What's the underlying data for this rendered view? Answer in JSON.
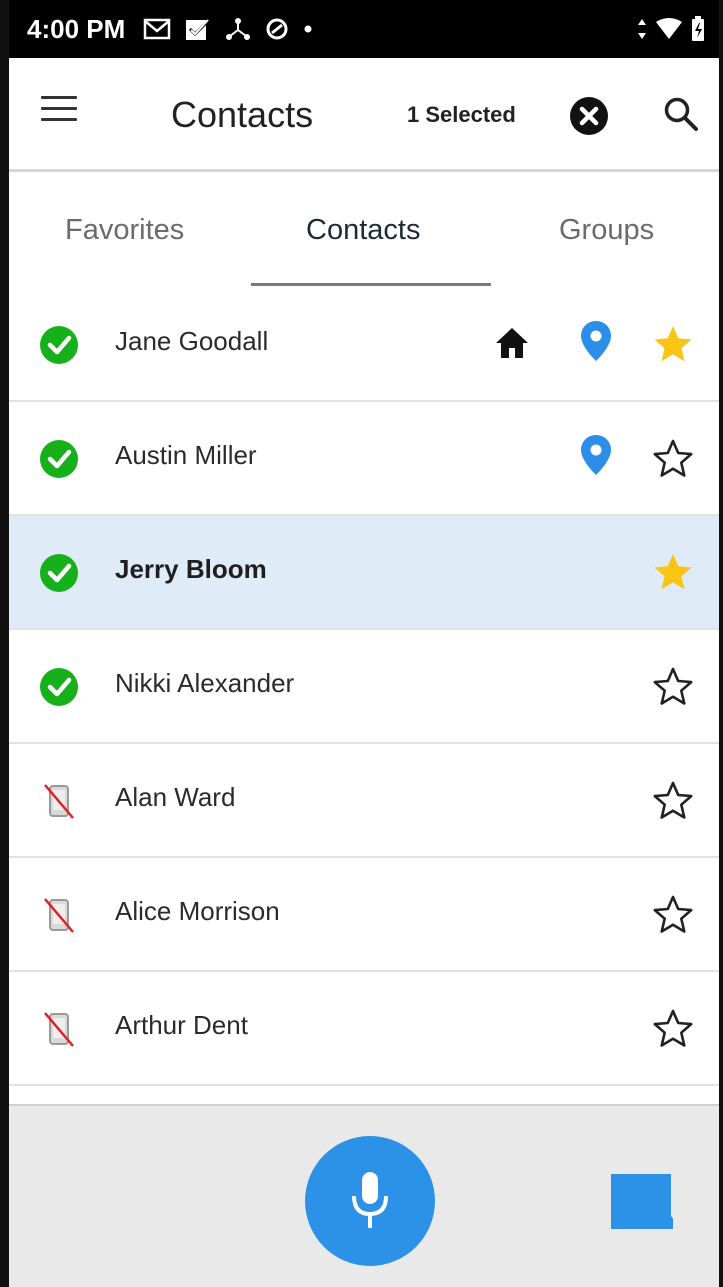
{
  "status_bar": {
    "time": "4:00 PM",
    "icons": [
      "gmail-icon",
      "task-icon",
      "network-icon",
      "sync-icon",
      "dot-icon"
    ],
    "right_icons": [
      "data-arrows-icon",
      "wifi-icon",
      "battery-icon"
    ]
  },
  "app_bar": {
    "title": "Contacts",
    "selected_text": "1 Selected"
  },
  "tabs": [
    {
      "label": "Favorites",
      "active": false
    },
    {
      "label": "Contacts",
      "active": true
    },
    {
      "label": "Groups",
      "active": false
    }
  ],
  "contacts": [
    {
      "name": "Jane Goodall",
      "status": "online",
      "home": true,
      "location": true,
      "favorite": true,
      "selected": false
    },
    {
      "name": "Austin Miller",
      "status": "online",
      "home": false,
      "location": true,
      "favorite": false,
      "selected": false
    },
    {
      "name": "Jerry Bloom",
      "status": "online",
      "home": false,
      "location": false,
      "favorite": true,
      "selected": true
    },
    {
      "name": "Nikki Alexander",
      "status": "online",
      "home": false,
      "location": false,
      "favorite": false,
      "selected": false
    },
    {
      "name": "Alan Ward",
      "status": "no-device",
      "home": false,
      "location": false,
      "favorite": false,
      "selected": false
    },
    {
      "name": "Alice Morrison",
      "status": "no-device",
      "home": false,
      "location": false,
      "favorite": false,
      "selected": false
    },
    {
      "name": "Arthur Dent",
      "status": "no-device",
      "home": false,
      "location": false,
      "favorite": false,
      "selected": false
    }
  ],
  "colors": {
    "online": "#16b01b",
    "location": "#2d8ee8",
    "favorite": "#f9c414",
    "selected_row": "#dfecf8",
    "mic_button": "#2c92e8",
    "message_button": "#2c92e8"
  }
}
